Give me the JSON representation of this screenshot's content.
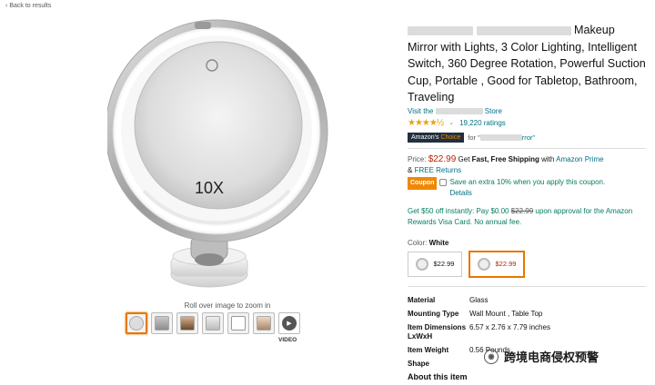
{
  "nav": {
    "back_label": "Back to results"
  },
  "product": {
    "title_suffix": "Makeup Mirror with Lights, 3 Color Lighting, Intelligent Switch, 360 Degree Rotation, Powerful Suction Cup, Portable , Good for Tabletop, Bathroom, Traveling",
    "store_prefix": "Visit the",
    "store_suffix": "Store",
    "ratings_count": "19,220 ratings",
    "stars": "★★★★½",
    "choice_badge_a": "Amazon's",
    "choice_badge_b": "Choice",
    "choice_for": "for \"",
    "choice_for_end": "rror\"",
    "image_zoom_label": "10X"
  },
  "price": {
    "label": "Price:",
    "amount": "$22.99",
    "shipping_a": "Get",
    "shipping_bold": "Fast, Free Shipping",
    "shipping_b": "with",
    "prime": "Amazon Prime",
    "amp": "&",
    "returns": "FREE Returns"
  },
  "coupon": {
    "badge": "Coupon",
    "text": "Save an extra 10% when you apply this coupon.",
    "details": "Details"
  },
  "offer": {
    "a": "Get $50 off instantly: Pay $0.00",
    "strike": "$22.99",
    "b": "upon approval for the Amazon Rewards Visa Card. No annual fee."
  },
  "color": {
    "label": "Color:",
    "value": "White",
    "options": [
      {
        "price": "$22.99"
      },
      {
        "price": "$22.99"
      }
    ]
  },
  "specs": [
    {
      "k": "Material",
      "v": "Glass"
    },
    {
      "k": "Mounting Type",
      "v": "Wall Mount , Table Top"
    },
    {
      "k": "Item Dimensions LxWxH",
      "v": "6.57 x 2.76 x 7.79 inches"
    },
    {
      "k": "Item Weight",
      "v": "0.56 Pounds"
    },
    {
      "k": "Shape",
      "v": ""
    }
  ],
  "gallery": {
    "zoom_hint": "Roll over image to zoom in",
    "video_label": "VIDEO"
  },
  "about_label": "About this item",
  "watermark": "跨境电商侵权预警",
  "colors": {
    "link": "#007185",
    "price": "#b12704",
    "accent": "#e77600",
    "green": "#067d62"
  }
}
